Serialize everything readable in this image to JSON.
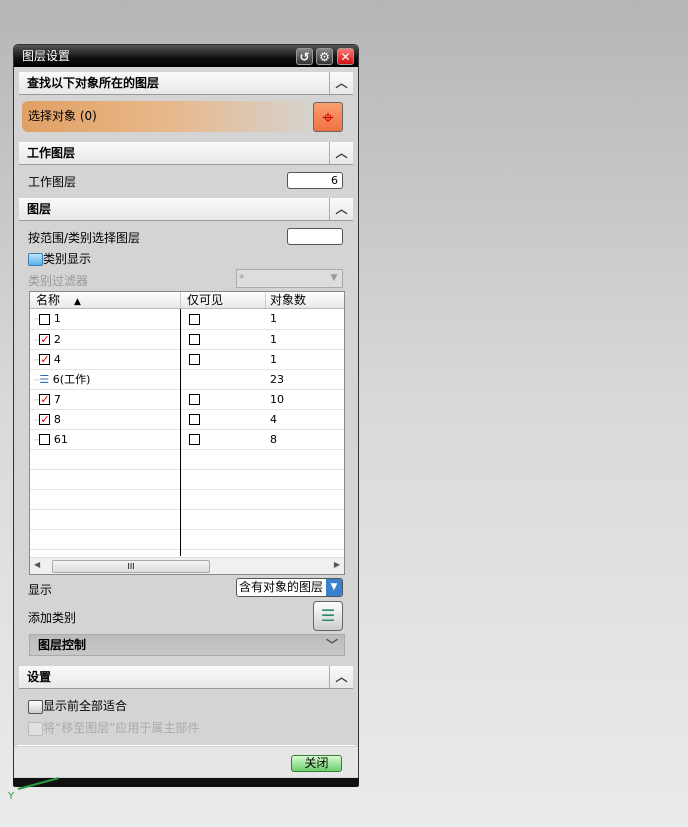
{
  "dialog": {
    "title": "图层设置",
    "title_buttons": [
      "reset-icon",
      "gear-icon",
      "close-icon"
    ]
  },
  "find_section": {
    "header": "查找以下对象所在的图层",
    "select_label": "选择对象 (0)"
  },
  "work_section": {
    "header": "工作图层",
    "label": "工作图层",
    "value": "6"
  },
  "layers_section": {
    "header": "图层",
    "range_label": "按范围/类别选择图层",
    "range_value": "",
    "category_display": "类别显示",
    "category_filter_label": "类别过滤器",
    "category_filter_value": "*",
    "table": {
      "columns": [
        "名称",
        "仅可见",
        "对象数"
      ],
      "rows": [
        {
          "name": "1",
          "checked": false,
          "visible_only": false,
          "count": "1"
        },
        {
          "name": "2",
          "checked": true,
          "visible_only": false,
          "count": "1"
        },
        {
          "name": "4",
          "checked": true,
          "visible_only": false,
          "count": "1"
        },
        {
          "name": "6(工作)",
          "work": true,
          "count": "23"
        },
        {
          "name": "7",
          "checked": true,
          "visible_only": false,
          "count": "10"
        },
        {
          "name": "8",
          "checked": true,
          "visible_only": false,
          "count": "4"
        },
        {
          "name": "61",
          "checked": false,
          "visible_only": false,
          "count": "8"
        }
      ]
    },
    "show_label": "显示",
    "show_value": "含有对象的图层",
    "add_category_label": "添加类别",
    "layer_control": "图层控制"
  },
  "settings_section": {
    "header": "设置",
    "fit_all": "显示前全部适合",
    "apply_move": "将“移至图层”应用于属主部件"
  },
  "footer": {
    "close_label": "关闭"
  },
  "axis": {
    "y_label": "Y"
  }
}
